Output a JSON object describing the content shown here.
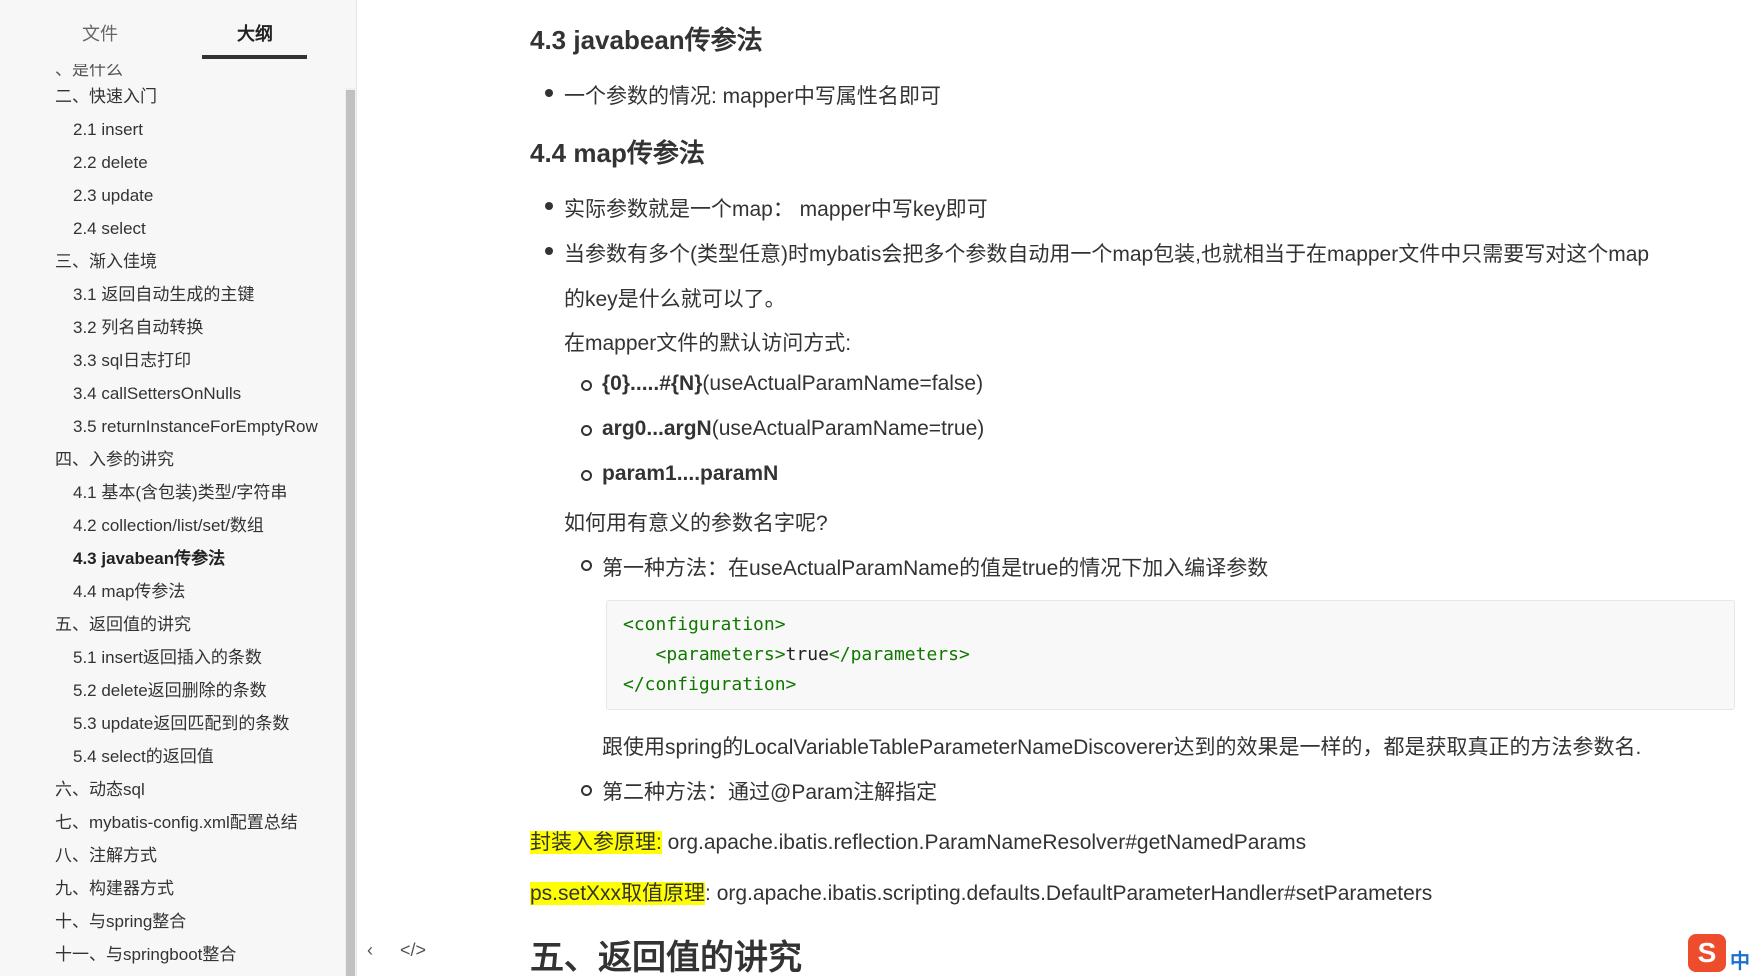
{
  "sidebar": {
    "tab_files": "文件",
    "tab_outline": "大纲",
    "partial_item": "、是什么",
    "items": [
      {
        "label": "二、快速入门",
        "level": 1
      },
      {
        "label": "2.1 insert",
        "level": 2
      },
      {
        "label": "2.2 delete",
        "level": 2
      },
      {
        "label": "2.3 update",
        "level": 2
      },
      {
        "label": "2.4 select",
        "level": 2
      },
      {
        "label": "三、渐入佳境",
        "level": 1
      },
      {
        "label": "3.1 返回自动生成的主键",
        "level": 2
      },
      {
        "label": "3.2 列名自动转换",
        "level": 2
      },
      {
        "label": "3.3 sql日志打印",
        "level": 2
      },
      {
        "label": "3.4 callSettersOnNulls",
        "level": 2
      },
      {
        "label": "3.5 returnInstanceForEmptyRow",
        "level": 2
      },
      {
        "label": "四、入参的讲究",
        "level": 1
      },
      {
        "label": "4.1 基本(含包装)类型/字符串",
        "level": 2
      },
      {
        "label": "4.2 collection/list/set/数组",
        "level": 2
      },
      {
        "label": "4.3 javabean传参法",
        "level": 2,
        "active": true
      },
      {
        "label": "4.4 map传参法",
        "level": 2
      },
      {
        "label": "五、返回值的讲究",
        "level": 1
      },
      {
        "label": "5.1 insert返回插入的条数",
        "level": 2
      },
      {
        "label": "5.2 delete返回删除的条数",
        "level": 2
      },
      {
        "label": "5.3 update返回匹配到的条数",
        "level": 2
      },
      {
        "label": "5.4 select的返回值",
        "level": 2
      },
      {
        "label": "六、动态sql",
        "level": 1
      },
      {
        "label": "七、mybatis-config.xml配置总结",
        "level": 1
      },
      {
        "label": "八、注解方式",
        "level": 1
      },
      {
        "label": "九、构建器方式",
        "level": 1
      },
      {
        "label": "十、与spring整合",
        "level": 1
      },
      {
        "label": "十一、与springboot整合",
        "level": 1
      }
    ]
  },
  "toolbar": {
    "back_glyph": "‹",
    "source_glyph": "</>"
  },
  "content": {
    "h_43": "4.3 javabean传参法",
    "p_43_bullet": "一个参数的情况: mapper中写属性名即可",
    "h_44": "4.4 map传参法",
    "p_44_b1": "实际参数就是一个map： mapper中写key即可",
    "p_44_b2_l1": "当参数有多个(类型任意)时mybatis会把多个参数自动用一个map包装,也就相当于在mapper文件中只需要写对这个map",
    "p_44_b2_l2": "的key是什么就可以了。",
    "p_default": "在mapper文件的默认访问方式:",
    "sub1_bold": "{0}.....#{N}",
    "sub1_rest": "(useActualParamName=false)",
    "sub2_bold": "arg0...argN",
    "sub2_rest": "(useActualParamName=true)",
    "sub3_bold": "param1....paramN",
    "p_question": "如何用有意义的参数名字呢?",
    "method1": "第一种方法：在useActualParamName的值是true的情况下加入编译参数",
    "code_l1_open": "<configuration>",
    "code_l2_open": "<parameters>",
    "code_l2_text": "true",
    "code_l2_close": "</parameters>",
    "code_l3_close": "</configuration>",
    "p_after_code": "跟使用spring的LocalVariableTableParameterNameDiscoverer达到的效果是一样的，都是获取真正的方法参数名.",
    "method2": "第二种方法：通过@Param注解指定",
    "hl1_label": "封装入参原理:",
    "hl1_value": " org.apache.ibatis.reflection.ParamNameResolver#getNamedParams",
    "hl2_label": "ps.setXxx取值原理",
    "hl2_value": ": org.apache.ibatis.scripting.defaults.DefaultParameterHandler#setParameters",
    "h_5": "五、返回值的讲究"
  },
  "ime": {
    "logo": "S",
    "char": "中"
  },
  "colors": {
    "highlight": "#ffff00",
    "xml_tag": "#117700",
    "sidebar_bg": "#f7f7f7"
  }
}
